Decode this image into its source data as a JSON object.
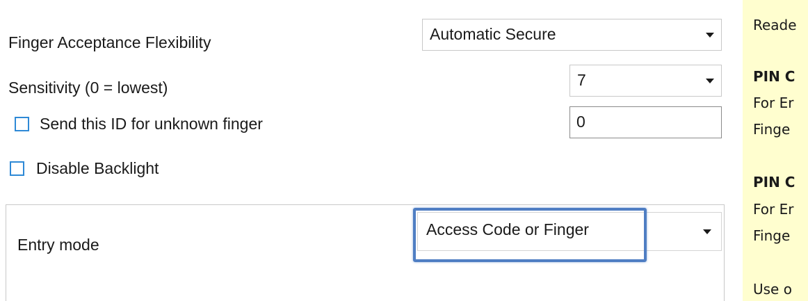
{
  "settings": {
    "finger_acceptance": {
      "label": "Finger Acceptance Flexibility",
      "value": "Automatic Secure"
    },
    "sensitivity": {
      "label": "Sensitivity (0 = lowest)",
      "value": "7"
    },
    "unknown_finger": {
      "label": "Send this ID for unknown finger",
      "checked": false,
      "value": "0"
    },
    "disable_backlight": {
      "label": "Disable Backlight",
      "checked": false
    },
    "entry_mode": {
      "label": "Entry mode",
      "value": "Access Code or Finger"
    }
  },
  "help_panel": {
    "lines": [
      "Reade",
      "PIN C",
      "For Er",
      "Finge",
      "PIN C",
      "For Er",
      "Finge",
      "Use o"
    ]
  },
  "colors": {
    "checkbox_border": "#2e89d6",
    "highlight_border": "#4f7ec3",
    "help_panel_background": "#fffecf"
  }
}
